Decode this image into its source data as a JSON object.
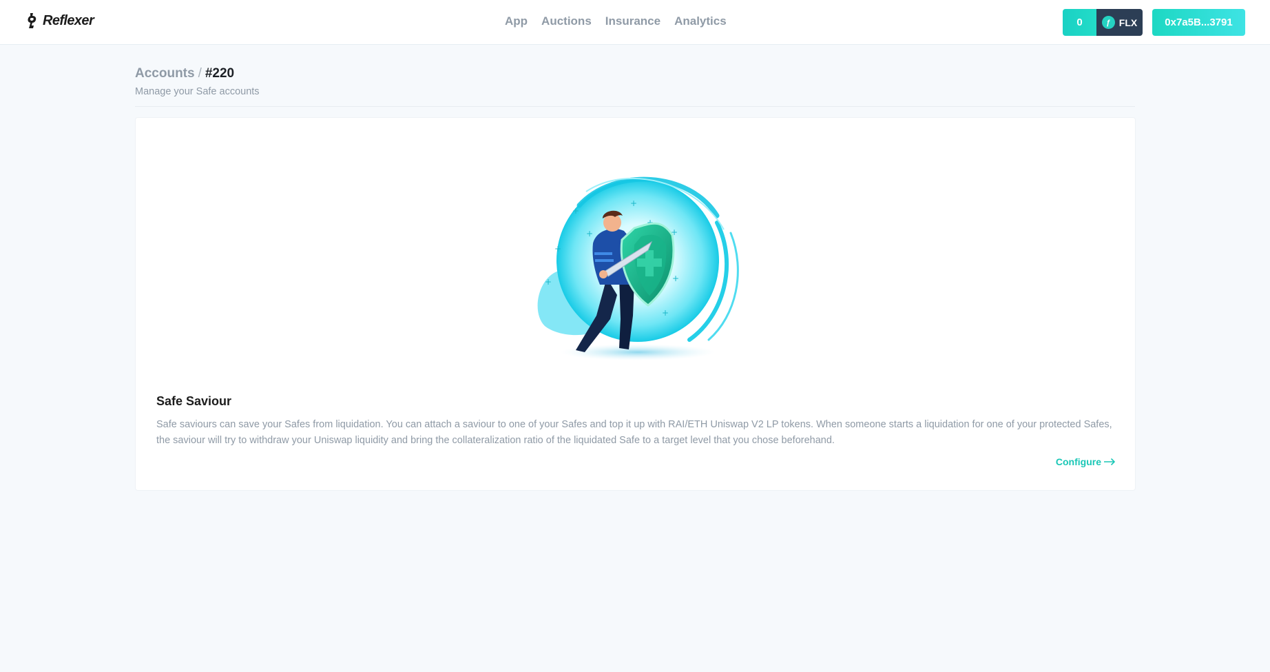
{
  "header": {
    "brand": "Reflexer",
    "nav": [
      "App",
      "Auctions",
      "Insurance",
      "Analytics"
    ],
    "flx_balance": "0",
    "flx_symbol": "FLX",
    "wallet_address": "0x7a5B...3791"
  },
  "page": {
    "breadcrumb_parent": "Accounts",
    "breadcrumb_separator": "/",
    "breadcrumb_current": "#220",
    "subtitle": "Manage your Safe accounts"
  },
  "card": {
    "title": "Safe Saviour",
    "description": "Safe saviours can save your Safes from liquidation. You can attach a saviour to one of your Safes and top it up with RAI/ETH Uniswap V2 LP tokens. When someone starts a liquidation for one of your protected Safes, the saviour will try to withdraw your Uniswap liquidity and bring the collateralization ratio of the liquidated Safe to a target level that you chose beforehand.",
    "action_label": "Configure"
  },
  "colors": {
    "accent": "#1ac7b6",
    "flx_dark": "#2c3e55",
    "page_background": "#f6f9fc"
  },
  "icons": [
    "reflexer-logo-icon",
    "flx-coin-icon",
    "arrow-right-icon"
  ]
}
